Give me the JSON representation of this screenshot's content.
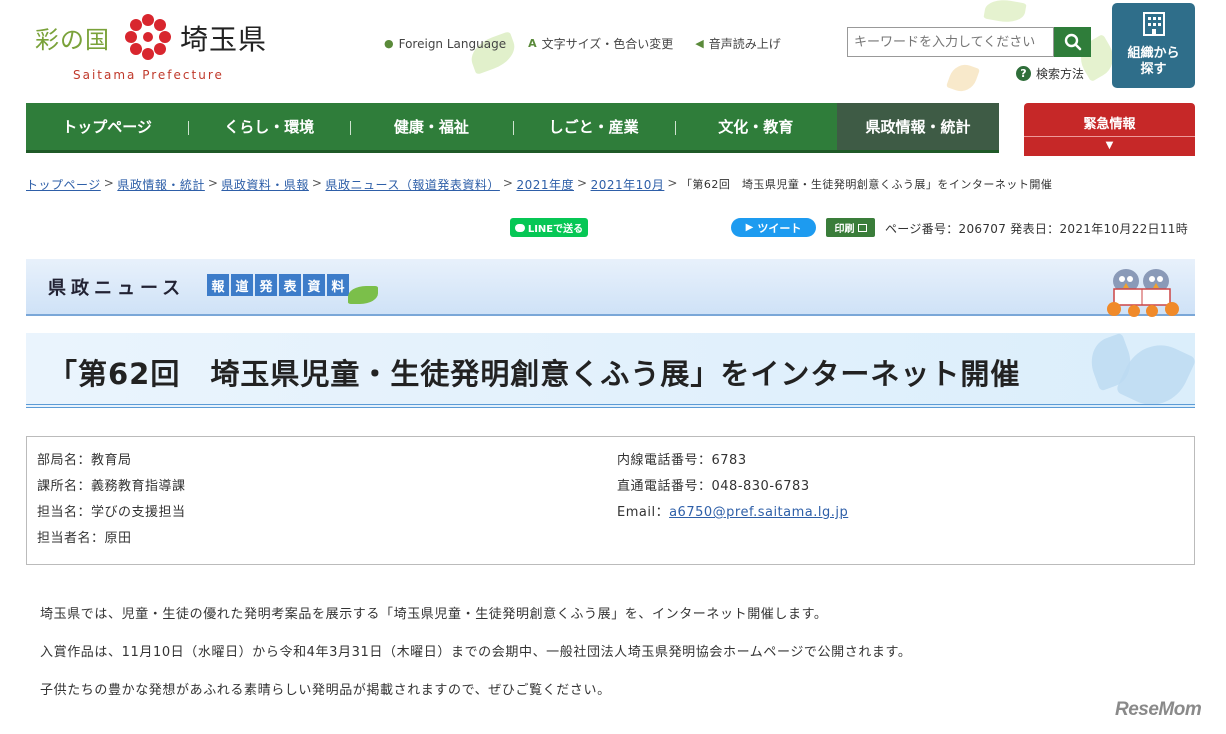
{
  "header": {
    "logo_sai": "彩の国",
    "logo_ken": "埼玉県",
    "logo_en": "Saitama Prefecture",
    "links": [
      {
        "label": "Foreign Language",
        "icon": "globe-icon"
      },
      {
        "label": "文字サイズ・色合い変更",
        "icon": "text-size-icon"
      },
      {
        "label": "音声読み上げ",
        "icon": "speaker-icon"
      }
    ],
    "search_placeholder": "キーワードを入力してください",
    "search_help": "検索方法",
    "org_button": "組織から探す"
  },
  "nav": {
    "items": [
      "トップページ",
      "くらし・環境",
      "健康・福祉",
      "しごと・産業",
      "文化・教育",
      "県政情報・統計"
    ],
    "active_index": 5,
    "emergency": "緊急情報"
  },
  "breadcrumb": [
    {
      "label": "トップページ",
      "link": true
    },
    {
      "label": "県政情報・統計",
      "link": true
    },
    {
      "label": "県政資料・県報",
      "link": true
    },
    {
      "label": "県政ニュース（報道発表資料）",
      "link": true
    },
    {
      "label": "2021年度",
      "link": true
    },
    {
      "label": "2021年10月",
      "link": true
    },
    {
      "label": "「第62回　埼玉県児童・生徒発明創意くふう展」をインターネット開催",
      "link": false
    }
  ],
  "share": {
    "line": "LINEで送る",
    "tweet": "ツイート",
    "print": "印刷",
    "page_meta": "ページ番号：206707  発表日：2021年10月22日11時"
  },
  "news_banner": {
    "title": "県政ニュース",
    "tags": [
      "報",
      "道",
      "発",
      "表",
      "資",
      "料"
    ]
  },
  "page_title": "「第62回　埼玉県児童・生徒発明創意くふう展」をインターネット開催",
  "contact": {
    "left": [
      "部局名：教育局",
      "課所名：義務教育指導課",
      "担当名：学びの支援担当",
      "担当者名：原田"
    ],
    "right": [
      "内線電話番号：6783",
      "直通電話番号：048-830-6783"
    ],
    "email_label": "Email：",
    "email": "a6750@pref.saitama.lg.jp"
  },
  "body": [
    "埼玉県では、児童・生徒の優れた発明考案品を展示する「埼玉県児童・生徒発明創意くふう展」を、インターネット開催します。",
    "入賞作品は、11月10日（水曜日）から令和4年3月31日（木曜日）までの会期中、一般社団法人埼玉県発明協会ホームページで公開されます。",
    "子供たちの豊かな発想があふれる素晴らしい発明品が掲載されますので、ぜひご覧ください。"
  ],
  "watermark": "ReseMom",
  "colors": {
    "nav_green": "#2f7d3a",
    "nav_active": "#3e5b45",
    "emergency_red": "#c62828",
    "link_blue": "#2e5fa8",
    "banner_blue": "#3d7cc9"
  }
}
